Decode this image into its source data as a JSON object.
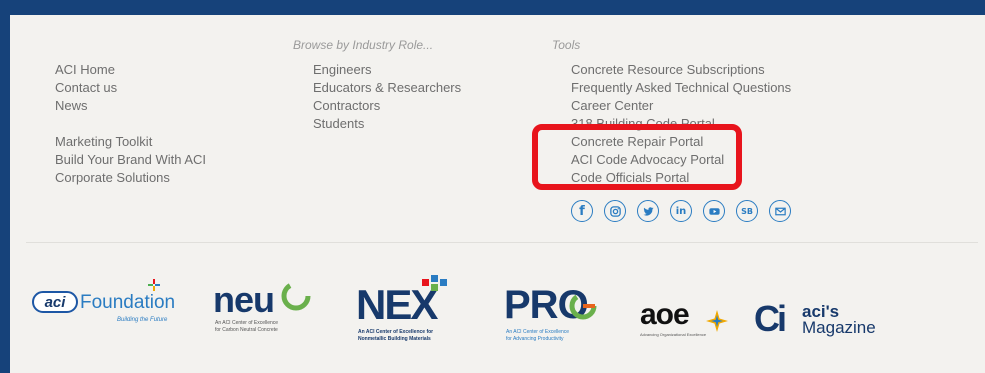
{
  "columns": {
    "col1": {
      "heading": "",
      "links_a": [
        "ACI Home",
        "Contact us",
        "News"
      ],
      "links_b": [
        "Marketing Toolkit",
        "Build Your Brand With ACI",
        "Corporate Solutions"
      ]
    },
    "col2": {
      "heading": "Browse by Industry Role...",
      "links": [
        "Engineers",
        "Educators & Researchers",
        "Contractors",
        "Students"
      ]
    },
    "col3": {
      "heading": "Tools",
      "links": [
        "Concrete Resource Subscriptions",
        "Frequently Asked Technical Questions",
        "Career Center",
        "318 Building Code Portal",
        "Concrete Repair Portal",
        "ACI Code Advocacy Portal",
        "Code Officials Portal"
      ]
    }
  },
  "social": [
    {
      "icon": "facebook-icon",
      "glyph": "f"
    },
    {
      "icon": "instagram-icon",
      "glyph": ""
    },
    {
      "icon": "twitter-icon",
      "glyph": ""
    },
    {
      "icon": "linkedin-icon",
      "glyph": "in"
    },
    {
      "icon": "youtube-icon",
      "glyph": ""
    },
    {
      "icon": "smartbrief-icon",
      "glyph": "SB"
    },
    {
      "icon": "email-icon",
      "glyph": ""
    }
  ],
  "logos": {
    "foundation": {
      "badge": "aci",
      "name": "Foundation",
      "tagline": "Building the Future"
    },
    "neu": {
      "name": "neu",
      "line1": "An ACI Center of Excellence",
      "line2": "for Carbon Neutral Concrete"
    },
    "nex": {
      "name": "NEX",
      "line1": "An ACI Center of Excellence for",
      "line2": "Nonmetallic Building Materials"
    },
    "pro": {
      "name": "PRO",
      "line1": "An ACI Center of Excellence",
      "line2": "for Advancing Productivity"
    },
    "aoe": {
      "name": "aoe",
      "line1": "Advancing Organizational Excellence"
    },
    "magazine": {
      "mark": "Ci",
      "name1": "aci's",
      "name2": "Magazine"
    }
  },
  "colors": {
    "highlight": "#e8141c",
    "accent": "#2a7cc2",
    "navy": "#17396b"
  }
}
